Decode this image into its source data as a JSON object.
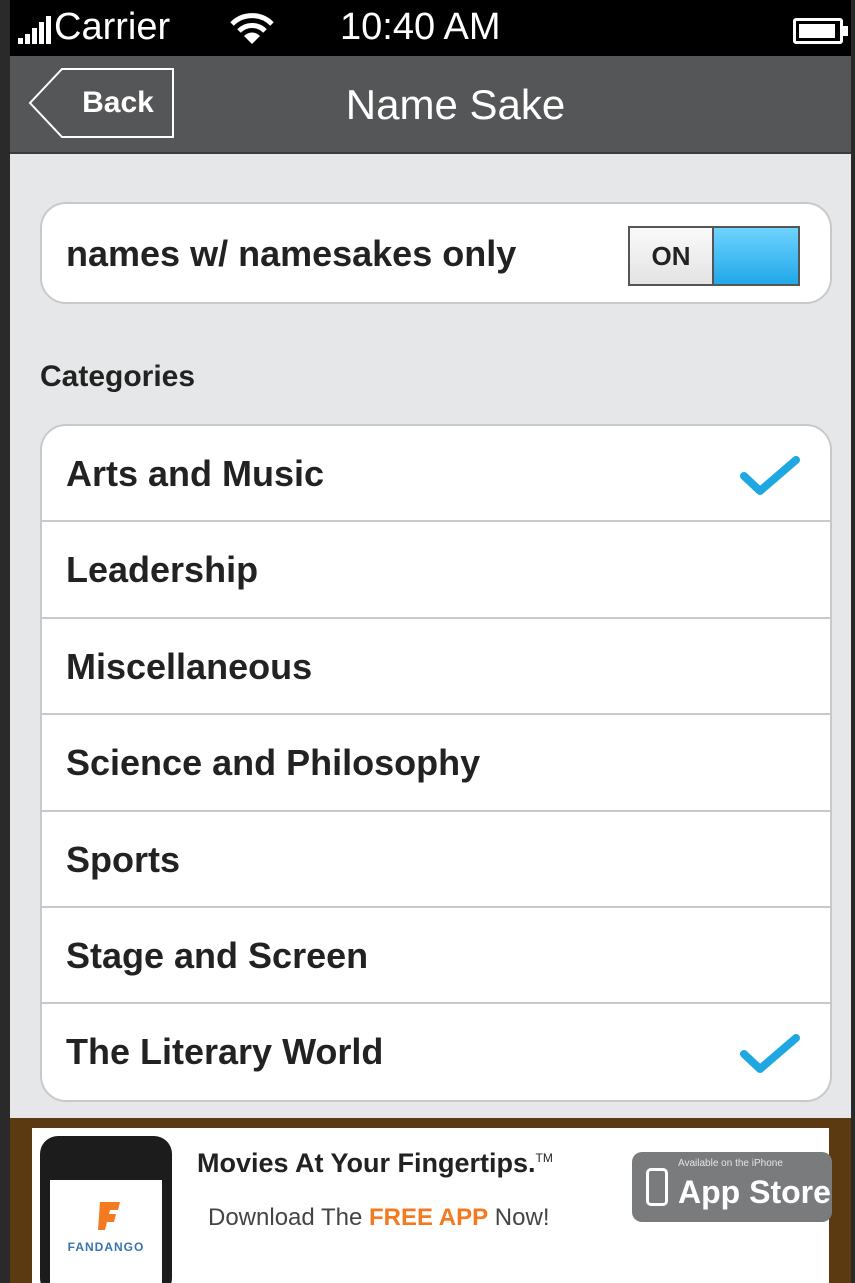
{
  "status_bar": {
    "carrier": "Carrier",
    "time": "10:40 AM"
  },
  "nav": {
    "back_label": "Back",
    "title": "Name Sake"
  },
  "filter": {
    "label": "names w/ namesakes only",
    "switch_text": "ON",
    "switch_on": true
  },
  "categories": {
    "header": "Categories",
    "items": [
      {
        "label": "Arts and Music",
        "checked": true
      },
      {
        "label": "Leadership",
        "checked": false
      },
      {
        "label": "Miscellaneous",
        "checked": false
      },
      {
        "label": "Science and Philosophy",
        "checked": false
      },
      {
        "label": "Sports",
        "checked": false
      },
      {
        "label": "Stage and Screen",
        "checked": false
      },
      {
        "label": "The Literary World",
        "checked": true
      }
    ]
  },
  "ad": {
    "brand": "FANDANGO",
    "headline": "Movies At Your Fingertips.",
    "trademark": "TM",
    "subline_prefix": "Download The ",
    "subline_highlight": "FREE APP",
    "subline_suffix": " Now!",
    "store_small": "Available on the iPhone",
    "store_big": "App Store"
  },
  "colors": {
    "accent": "#1ea7e1",
    "nav_bar": "#555657",
    "background": "#e6e7e8",
    "ad_highlight": "#f47a20"
  }
}
